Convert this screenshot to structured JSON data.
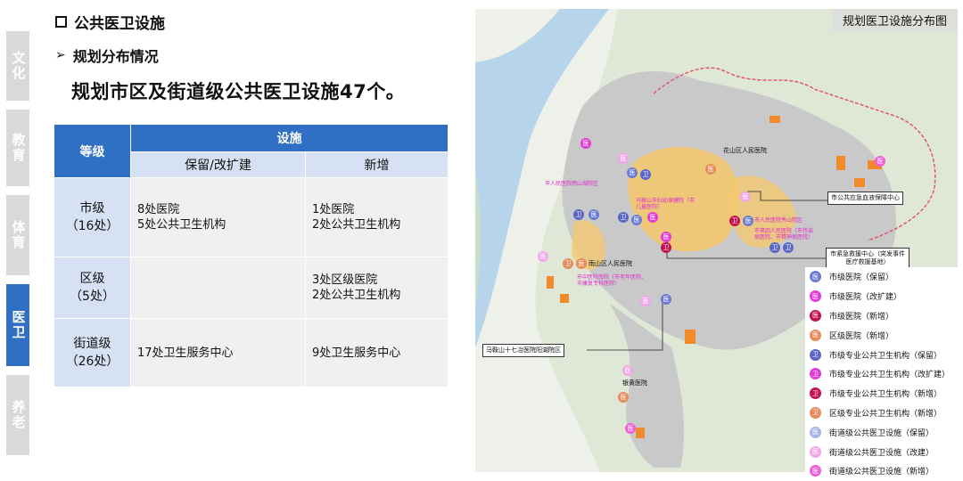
{
  "side_tabs": [
    {
      "label": "文化",
      "active": false
    },
    {
      "label": "教育",
      "active": false
    },
    {
      "label": "体育",
      "active": false
    },
    {
      "label": "医卫",
      "active": true
    },
    {
      "label": "养老",
      "active": false
    }
  ],
  "heading1": "公共医卫设施",
  "heading2": "规划分布情况",
  "summary": "规划市区及街道级公共医卫设施47个。",
  "table": {
    "col_level": "等级",
    "col_facility": "设施",
    "col_keep": "保留/改扩建",
    "col_new": "新增",
    "rows": [
      {
        "level": "市级",
        "count": "（16处）",
        "keep": [
          "8处医院",
          "5处公共卫生机构"
        ],
        "new": [
          "1处医院",
          "2处公共卫生机构"
        ]
      },
      {
        "level": "区级",
        "count": "（5处）",
        "keep": [],
        "new": [
          "3处区级医院",
          "2处公共卫生机构"
        ]
      },
      {
        "level": "街道级",
        "count": "（26处）",
        "keep": [
          "17处卫生服务中心"
        ],
        "new": [
          "9处卫生服务中心"
        ]
      }
    ]
  },
  "map": {
    "title": "规划医卫设施分布图",
    "callouts": {
      "emergency_center": "市公共应急血液保障中心",
      "first_aid": "市紧急救援中心（突发事件医疗救援基地）",
      "maanshan17": "马鞍山十七冶医院阳湖院区"
    },
    "labels": {
      "huashan": "花山区人民医院",
      "yushan": "雨山区人民医院",
      "yinhuang": "银黄医院"
    },
    "pink_labels": {
      "pl1": "市人民医院雨山湖院区",
      "pl2": "马鞍山市妇幼保健院（市儿童医院）",
      "pl3": "市人民医院秀山院区",
      "pl4": "市第四人民医院（市传染病医院、市精神病医院）",
      "pl5": "市中医院南院（市老年医院、市康复专科医院）"
    },
    "icon_glyph_yi": "医",
    "icon_glyph_wei": "卫"
  },
  "legend": [
    {
      "label": "市级医院（保留）",
      "glyph": "医",
      "color": "#6a7bd6",
      "style": "solid"
    },
    {
      "label": "市级医院（改扩建）",
      "glyph": "医",
      "color": "#e33bd6",
      "style": "solid"
    },
    {
      "label": "市级医院（新增）",
      "glyph": "医",
      "color": "#c4124f",
      "style": "solid"
    },
    {
      "label": "区级医院（新增）",
      "glyph": "医",
      "color": "#e88b5a",
      "style": "solid"
    },
    {
      "label": "市级专业公共卫生机构（保留）",
      "glyph": "卫",
      "color": "#5a66c8",
      "style": "solid"
    },
    {
      "label": "市级专业公共卫生机构（改扩建）",
      "glyph": "卫",
      "color": "#e33bd6",
      "style": "solid"
    },
    {
      "label": "市级专业公共卫生机构（新增）",
      "glyph": "卫",
      "color": "#c4124f",
      "style": "solid"
    },
    {
      "label": "区级专业公共卫生机构（新增）",
      "glyph": "卫",
      "color": "#e88b5a",
      "style": "solid"
    },
    {
      "label": "街道级公共医卫设施（保留）",
      "glyph": "医",
      "color": "#a8b4e6",
      "style": "solid"
    },
    {
      "label": "街道级公共医卫设施（改建）",
      "glyph": "医",
      "color": "#f2a7ea",
      "style": "solid"
    },
    {
      "label": "街道级公共医卫设施（新增）",
      "glyph": "医",
      "color": "#ee5fd9",
      "style": "solid"
    }
  ]
}
